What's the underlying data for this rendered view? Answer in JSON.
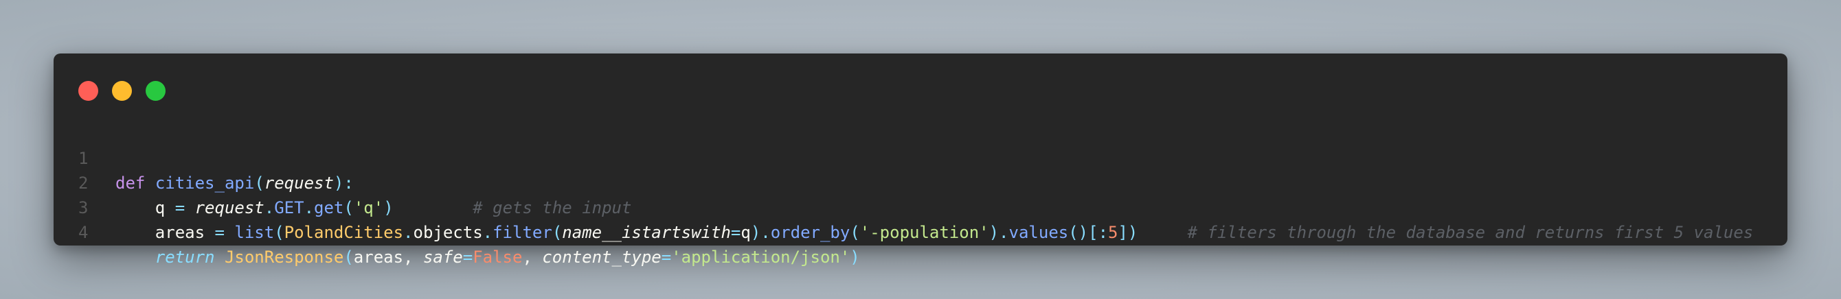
{
  "window": {
    "buttons": [
      {
        "name": "close",
        "color": "#ff5f57"
      },
      {
        "name": "minimize",
        "color": "#febc2e"
      },
      {
        "name": "zoom",
        "color": "#28c840"
      }
    ]
  },
  "code": {
    "lines": [
      {
        "number": "1",
        "tokens": [
          {
            "t": "def",
            "c": "kw"
          },
          {
            "t": " ",
            "c": ""
          },
          {
            "t": "cities_api",
            "c": "fn"
          },
          {
            "t": "(",
            "c": "par"
          },
          {
            "t": "request",
            "c": "it"
          },
          {
            "t": "):",
            "c": "par"
          }
        ]
      },
      {
        "number": "2",
        "tokens": [
          {
            "t": "    q ",
            "c": ""
          },
          {
            "t": "=",
            "c": "op"
          },
          {
            "t": " ",
            "c": ""
          },
          {
            "t": "request",
            "c": "it"
          },
          {
            "t": ".",
            "c": "op"
          },
          {
            "t": "GET",
            "c": "fn"
          },
          {
            "t": ".",
            "c": "op"
          },
          {
            "t": "get",
            "c": "fn"
          },
          {
            "t": "(",
            "c": "par"
          },
          {
            "t": "'q'",
            "c": "str"
          },
          {
            "t": ")",
            "c": "par"
          },
          {
            "t": "        ",
            "c": ""
          },
          {
            "t": "# gets the input",
            "c": "cm"
          }
        ]
      },
      {
        "number": "3",
        "tokens": [
          {
            "t": "    areas ",
            "c": ""
          },
          {
            "t": "=",
            "c": "op"
          },
          {
            "t": " ",
            "c": ""
          },
          {
            "t": "list",
            "c": "fn"
          },
          {
            "t": "(",
            "c": "par"
          },
          {
            "t": "PolandCities",
            "c": "cls"
          },
          {
            "t": ".",
            "c": "op"
          },
          {
            "t": "objects",
            "c": ""
          },
          {
            "t": ".",
            "c": "op"
          },
          {
            "t": "filter",
            "c": "fn"
          },
          {
            "t": "(",
            "c": "par"
          },
          {
            "t": "name__istartswith",
            "c": "it"
          },
          {
            "t": "=",
            "c": "op"
          },
          {
            "t": "q",
            "c": ""
          },
          {
            "t": ").",
            "c": "par"
          },
          {
            "t": "order_by",
            "c": "fn"
          },
          {
            "t": "(",
            "c": "par"
          },
          {
            "t": "'-population'",
            "c": "str"
          },
          {
            "t": ").",
            "c": "par"
          },
          {
            "t": "values",
            "c": "fn"
          },
          {
            "t": "()[:",
            "c": "par"
          },
          {
            "t": "5",
            "c": "num"
          },
          {
            "t": "])",
            "c": "par"
          },
          {
            "t": "     ",
            "c": ""
          },
          {
            "t": "# filters through the database and returns first 5 values",
            "c": "cm"
          }
        ]
      },
      {
        "number": "4",
        "tokens": [
          {
            "t": "    ",
            "c": ""
          },
          {
            "t": "return",
            "c": "kwi"
          },
          {
            "t": " ",
            "c": ""
          },
          {
            "t": "JsonResponse",
            "c": "cls"
          },
          {
            "t": "(",
            "c": "par"
          },
          {
            "t": "areas, ",
            "c": ""
          },
          {
            "t": "safe",
            "c": "it"
          },
          {
            "t": "=",
            "c": "op"
          },
          {
            "t": "False",
            "c": "num"
          },
          {
            "t": ", ",
            "c": ""
          },
          {
            "t": "content_type",
            "c": "it"
          },
          {
            "t": "=",
            "c": "op"
          },
          {
            "t": "'application/json'",
            "c": "str"
          },
          {
            "t": ")",
            "c": "par"
          }
        ]
      }
    ]
  }
}
